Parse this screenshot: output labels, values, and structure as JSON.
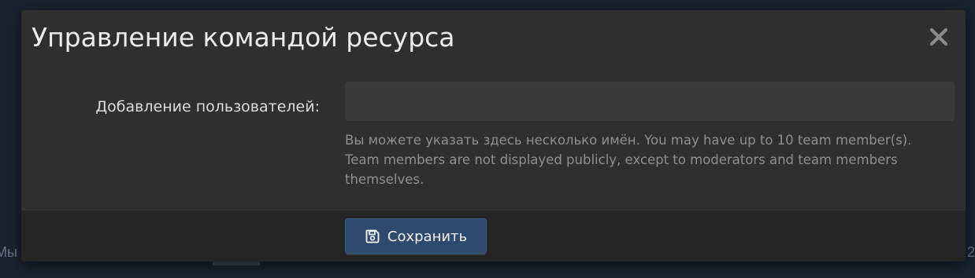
{
  "background": {
    "left_fragment": "Мы",
    "right_fragment": "2"
  },
  "modal": {
    "title": "Управление командой ресурса",
    "close_icon": "close-icon",
    "form": {
      "users_label": "Добавление пользователей:",
      "users_value": "",
      "users_placeholder": "",
      "hint": "Вы можете указать здесь несколько имён. You may have up to 10 team member(s). Team members are not displayed publicly, except to moderators and team members themselves."
    },
    "footer": {
      "save_label": "Сохранить",
      "save_icon": "save-icon"
    }
  },
  "colors": {
    "page_background": "#1a2330",
    "modal_background": "#2f2f2f",
    "footer_background": "#252525",
    "input_background": "#3a3a3a",
    "primary_button": "#2e4a6e",
    "title_text": "#ececec",
    "hint_text": "#8f8f8f"
  }
}
